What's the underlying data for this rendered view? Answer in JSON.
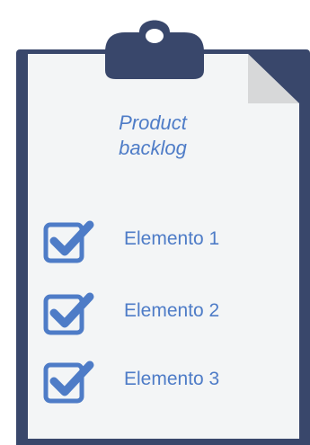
{
  "clipboard": {
    "title_lines": [
      "Product",
      "backlog"
    ],
    "items": [
      {
        "label": "Elemento 1",
        "checked": true
      },
      {
        "label": "Elemento 2",
        "checked": true
      },
      {
        "label": "Elemento 3",
        "checked": true
      }
    ]
  },
  "colors": {
    "board": "#39476b",
    "paper": "#f3f5f6",
    "accent": "#4e7cc7",
    "fold": "#d7d8d9"
  }
}
